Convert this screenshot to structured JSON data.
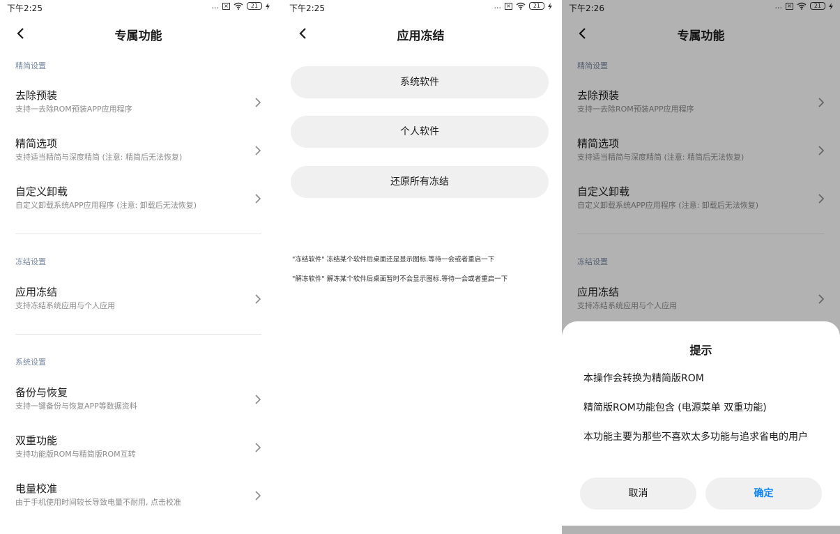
{
  "status": {
    "time_1": "下午2:25",
    "time_2": "下午2:25",
    "time_3": "下午2:26",
    "dots": "...",
    "battery_1": "21",
    "battery_2": "21",
    "battery_3": "21"
  },
  "screen1": {
    "title": "专属功能",
    "sections": [
      {
        "label": "精简设置",
        "items": [
          {
            "title": "去除预装",
            "desc": "支持一去除ROM预装APP应用程序"
          },
          {
            "title": "精简选项",
            "desc": "支持适当精简与深度精简 (注意: 精简后无法恢复)"
          },
          {
            "title": "自定义卸载",
            "desc": "自定义卸载系统APP应用程序 (注意: 卸载后无法恢复)"
          }
        ]
      },
      {
        "label": "冻结设置",
        "items": [
          {
            "title": "应用冻结",
            "desc": "支持冻结系统应用与个人应用"
          }
        ]
      },
      {
        "label": "系统设置",
        "items": [
          {
            "title": "备份与恢复",
            "desc": "支持一键备份与恢复APP等数据资料"
          },
          {
            "title": "双重功能",
            "desc": "支持功能版ROM与精简版ROM互转"
          },
          {
            "title": "电量校准",
            "desc": "由于手机使用时间较长导致电量不耐用, 点击校准"
          }
        ]
      }
    ]
  },
  "screen2": {
    "title": "应用冻结",
    "buttons": [
      "系统软件",
      "个人软件",
      "还原所有冻结"
    ],
    "notes": [
      "\"冻结软件\" 冻结某个软件后桌面还是显示图标.等待一会或者重启一下",
      "\"解冻软件\" 解冻某个软件后桌面暂时不会显示图标.等待一会或者重启一下"
    ]
  },
  "screen3": {
    "dialog": {
      "title": "提示",
      "lines": [
        "本操作会转换为精简版ROM",
        "精简版ROM功能包含 (电源菜单 双重功能)",
        "本功能主要为那些不喜欢太多功能与追求省电的用户"
      ],
      "cancel": "取消",
      "confirm": "确定"
    }
  },
  "colors": {
    "accent": "#0d84ff",
    "section_label": "#7a8aa5",
    "pill_bg": "#f0f0f0"
  }
}
